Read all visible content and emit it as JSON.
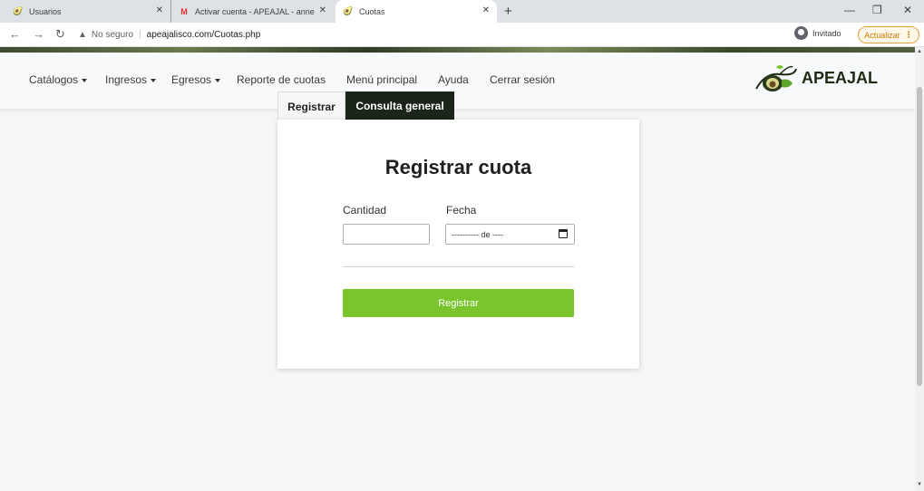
{
  "browser": {
    "tabs": [
      {
        "title": "Usuarios"
      },
      {
        "title": "Activar cuenta - APEAJAL - anne"
      },
      {
        "title": "Cuotas"
      }
    ],
    "new_tab_symbol": "+",
    "close_symbol": "✕",
    "address": {
      "security_label": "No seguro",
      "url": "apeajalisco.com/Cuotas.php"
    },
    "profile_label": "Invitado",
    "update_label": "Actualizar"
  },
  "navbar": {
    "items": [
      {
        "label": "Catálogos",
        "dropdown": true
      },
      {
        "label": "Ingresos",
        "dropdown": true
      },
      {
        "label": "Egresos",
        "dropdown": true
      },
      {
        "label": "Reporte de cuotas",
        "dropdown": false
      },
      {
        "label": "Menú principal",
        "dropdown": false
      },
      {
        "label": "Ayuda",
        "dropdown": false
      },
      {
        "label": "Cerrar sesión",
        "dropdown": false
      }
    ],
    "brand": "APEAJAL"
  },
  "form": {
    "tabs": [
      {
        "label": "Registrar",
        "active": true
      },
      {
        "label": "Consulta general",
        "active": false
      }
    ],
    "title": "Registrar cuota",
    "cantidad": {
      "label": "Cantidad",
      "value": ""
    },
    "fecha": {
      "label": "Fecha",
      "value": "---------- de ----"
    },
    "submit_label": "Registrar"
  },
  "colors": {
    "accent": "#7ac52e",
    "tab_dark": "#1c2519",
    "update_border": "#e0a340"
  }
}
